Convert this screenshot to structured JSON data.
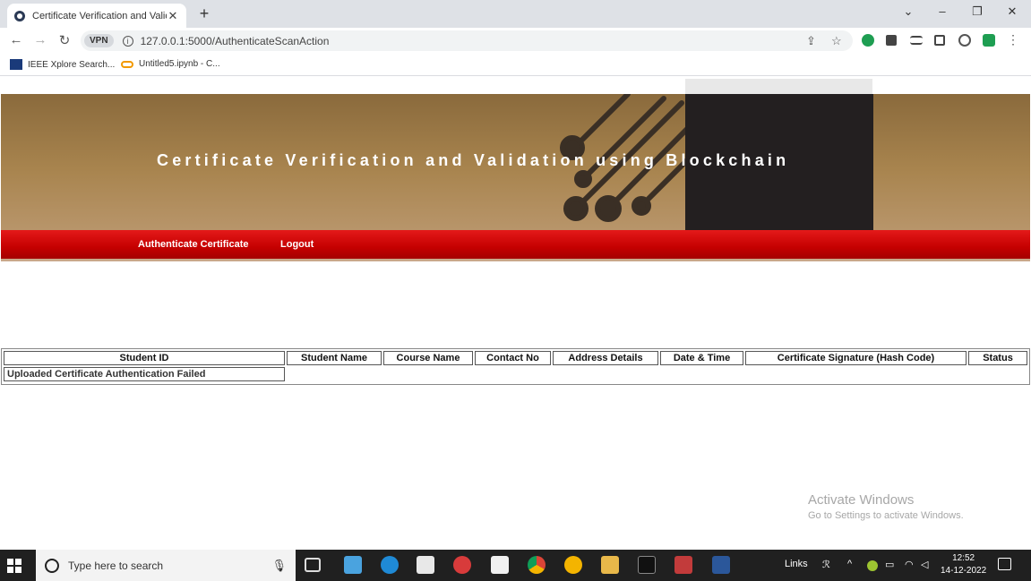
{
  "browser": {
    "tab_title": "Certificate Verification and Valida",
    "new_tab": "+",
    "vpn_badge": "VPN",
    "url": "127.0.0.1:5000/AuthenticateScanAction",
    "bookmarks": [
      {
        "label": "IEEE Xplore Search..."
      },
      {
        "label": "Untitled5.ipynb - C..."
      }
    ]
  },
  "page": {
    "banner_title": "Certificate Verification and Validation using Blockchain",
    "menu": {
      "authenticate": "Authenticate Certificate",
      "logout": "Logout"
    },
    "table": {
      "headers": [
        "Student ID",
        "Student Name",
        "Course Name",
        "Contact No",
        "Address Details",
        "Date & Time",
        "Certificate Signature (Hash Code)",
        "Status"
      ],
      "message": "Uploaded Certificate Authentication Failed"
    }
  },
  "watermark": {
    "line1": "Activate Windows",
    "line2": "Go to Settings to activate Windows."
  },
  "taskbar": {
    "search_placeholder": "Type here to search",
    "links_label": "Links",
    "time": "12:52",
    "date": "14-12-2022"
  }
}
